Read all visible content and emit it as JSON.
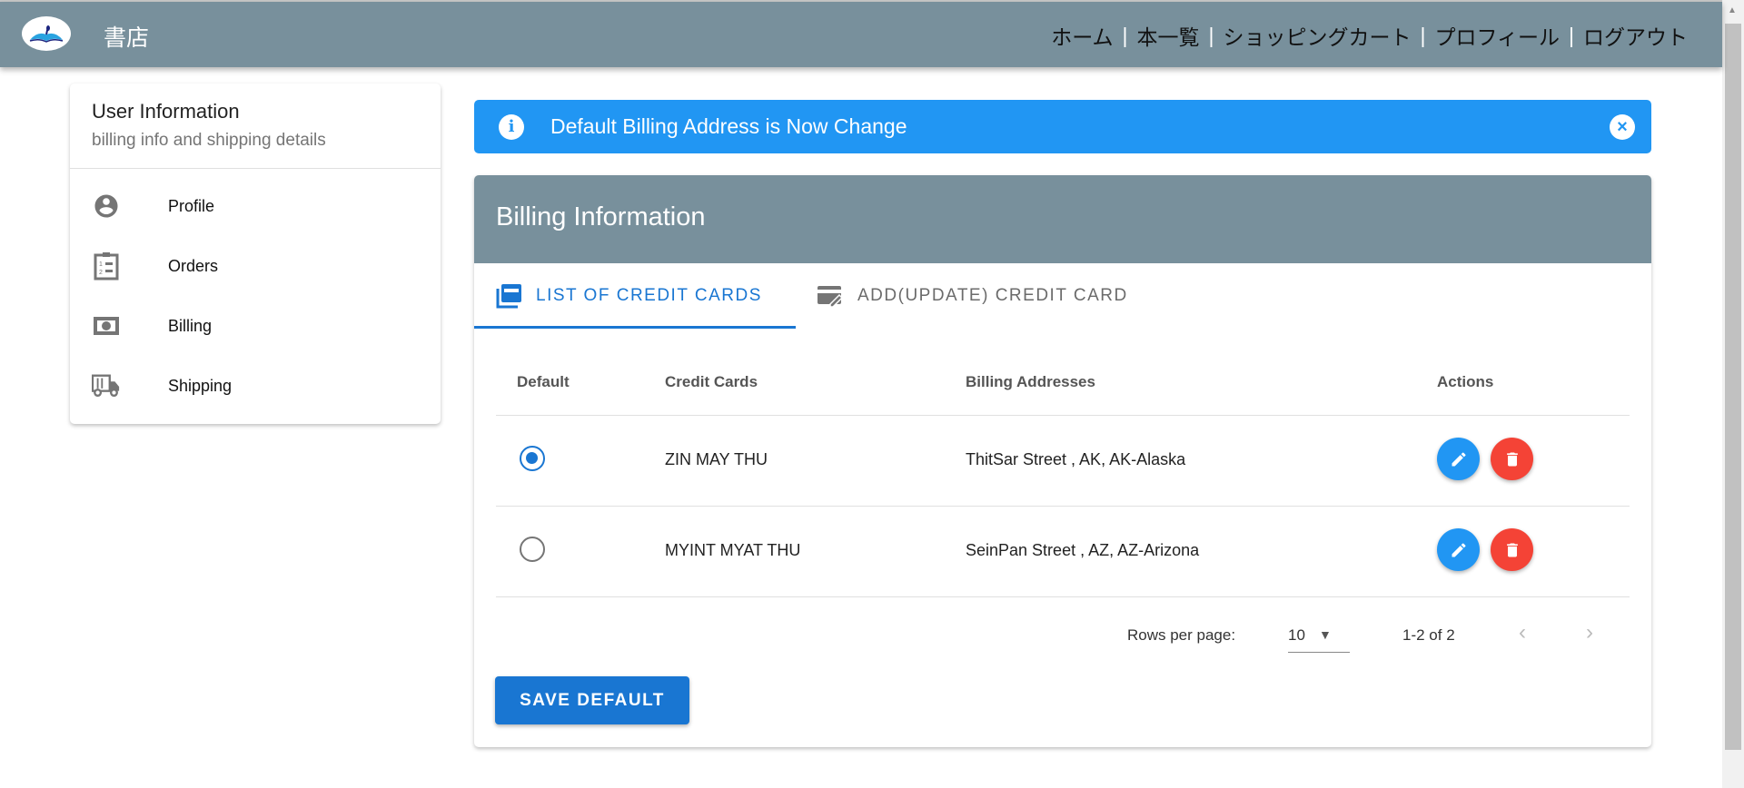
{
  "header": {
    "brand": "書店",
    "nav": [
      "ホーム",
      "本一覧",
      "ショッピングカート",
      "プロフィール",
      "ログアウト"
    ],
    "separator": "|"
  },
  "sidebar": {
    "title": "User Information",
    "subtitle": "billing info and shipping details",
    "items": [
      {
        "label": "Profile",
        "icon": "account-circle-icon"
      },
      {
        "label": "Orders",
        "icon": "clipboard-list-icon"
      },
      {
        "label": "Billing",
        "icon": "money-icon"
      },
      {
        "label": "Shipping",
        "icon": "truck-icon"
      }
    ]
  },
  "alert": {
    "text": "Default Billing Address is Now Change",
    "icon": "info-icon",
    "close": "×",
    "info_glyph": "i",
    "color": "#2196f3"
  },
  "billing": {
    "title": "Billing Information",
    "tabs": [
      {
        "label": "LIST OF CREDIT CARDS",
        "active": true
      },
      {
        "label": "ADD(UPDATE) CREDIT CARD",
        "active": false
      }
    ],
    "columns": [
      "Default",
      "Credit Cards",
      "Billing Addresses",
      "Actions"
    ],
    "rows": [
      {
        "default": true,
        "card": "ZIN MAY THU",
        "address": "ThitSar Street , AK, AK-Alaska"
      },
      {
        "default": false,
        "card": "MYINT MYAT THU",
        "address": "SeinPan Street , AZ, AZ-Arizona"
      }
    ],
    "pagination": {
      "rows_per_page_label": "Rows per page:",
      "rows_per_page": "10",
      "range": "1-2 of 2"
    },
    "save_label": "SAVE DEFAULT"
  },
  "colors": {
    "header": "#78909c",
    "primary": "#1976d2",
    "danger": "#f44336"
  }
}
